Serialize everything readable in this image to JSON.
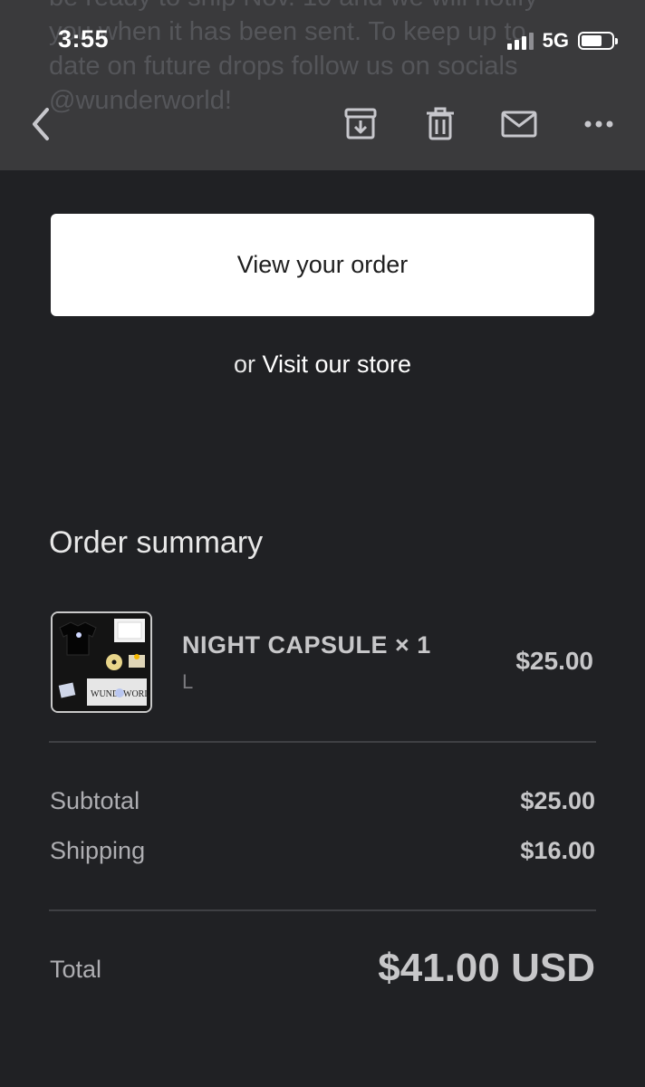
{
  "status_bar": {
    "time": "3:55",
    "network": "5G"
  },
  "email_preview": {
    "lines": [
      "be ready to ship Nov. 10 and we will notify",
      "you when it has been sent. To keep up to",
      "date on future drops follow us on socials",
      "@wunderworld!"
    ]
  },
  "toolbar": {
    "back_icon": "chevron-left-icon",
    "archive_icon": "archive-icon",
    "trash_icon": "trash-icon",
    "mail_icon": "mail-icon",
    "more_icon": "more-horizontal-icon"
  },
  "actions": {
    "view_order_label": "View your order",
    "store_prefix": "or",
    "store_link_label": "Visit our store"
  },
  "summary": {
    "title": "Order summary",
    "item": {
      "name": "NIGHT CAPSULE × 1",
      "variant": "L",
      "price": "$25.00",
      "thumbnail_text": "WUND",
      "thumbnail_text_2": "WORLD"
    },
    "subtotal_label": "Subtotal",
    "subtotal_value": "$25.00",
    "shipping_label": "Shipping",
    "shipping_value": "$16.00",
    "total_label": "Total",
    "total_value": "$41.00 USD"
  },
  "colors": {
    "background": "#202124",
    "header": "#3a3a3c",
    "button": "#ffffff"
  }
}
